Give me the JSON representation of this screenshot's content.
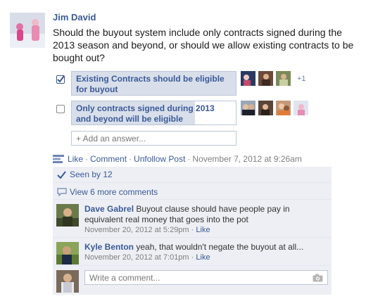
{
  "post": {
    "author": "Jim David",
    "question": "Should the buyout system include only contracts signed during the 2013 season and beyond, or should we allow existing contracts to be bought out?"
  },
  "poll": {
    "options": [
      {
        "label": "Existing Contracts should be eligible for buyout",
        "checked": true,
        "fill_fraction": 1.0,
        "extra_voters": "+1"
      },
      {
        "label": "Only contracts signed during 2013 and beyond will be eligible",
        "checked": false,
        "fill_fraction": 0.75
      }
    ],
    "add_answer_placeholder": "+ Add an answer..."
  },
  "actions": {
    "like": "Like",
    "comment": "Comment",
    "unfollow": "Unfollow Post",
    "timestamp": "November 7, 2012 at 9:26am",
    "separator": "·"
  },
  "ufi": {
    "seen_by": "Seen by 12",
    "view_more": "View 6 more comments"
  },
  "comments": [
    {
      "author": "Dave Gabrel",
      "text": "Buyout clause should have people pay in equivalent real money that goes into the pot",
      "time": "November 20, 2012 at 5:29pm",
      "like": "Like"
    },
    {
      "author": "Kyle Benton",
      "text": "yeah, that wouldn't negate the buyout at all...",
      "time": "November 20, 2012 at 7:01pm",
      "like": "Like"
    }
  ],
  "write_comment_placeholder": "Write a comment...",
  "colors": {
    "link": "#3b5998",
    "ufi_bg": "#edeff4",
    "poll_fill": "#d8dfea"
  }
}
